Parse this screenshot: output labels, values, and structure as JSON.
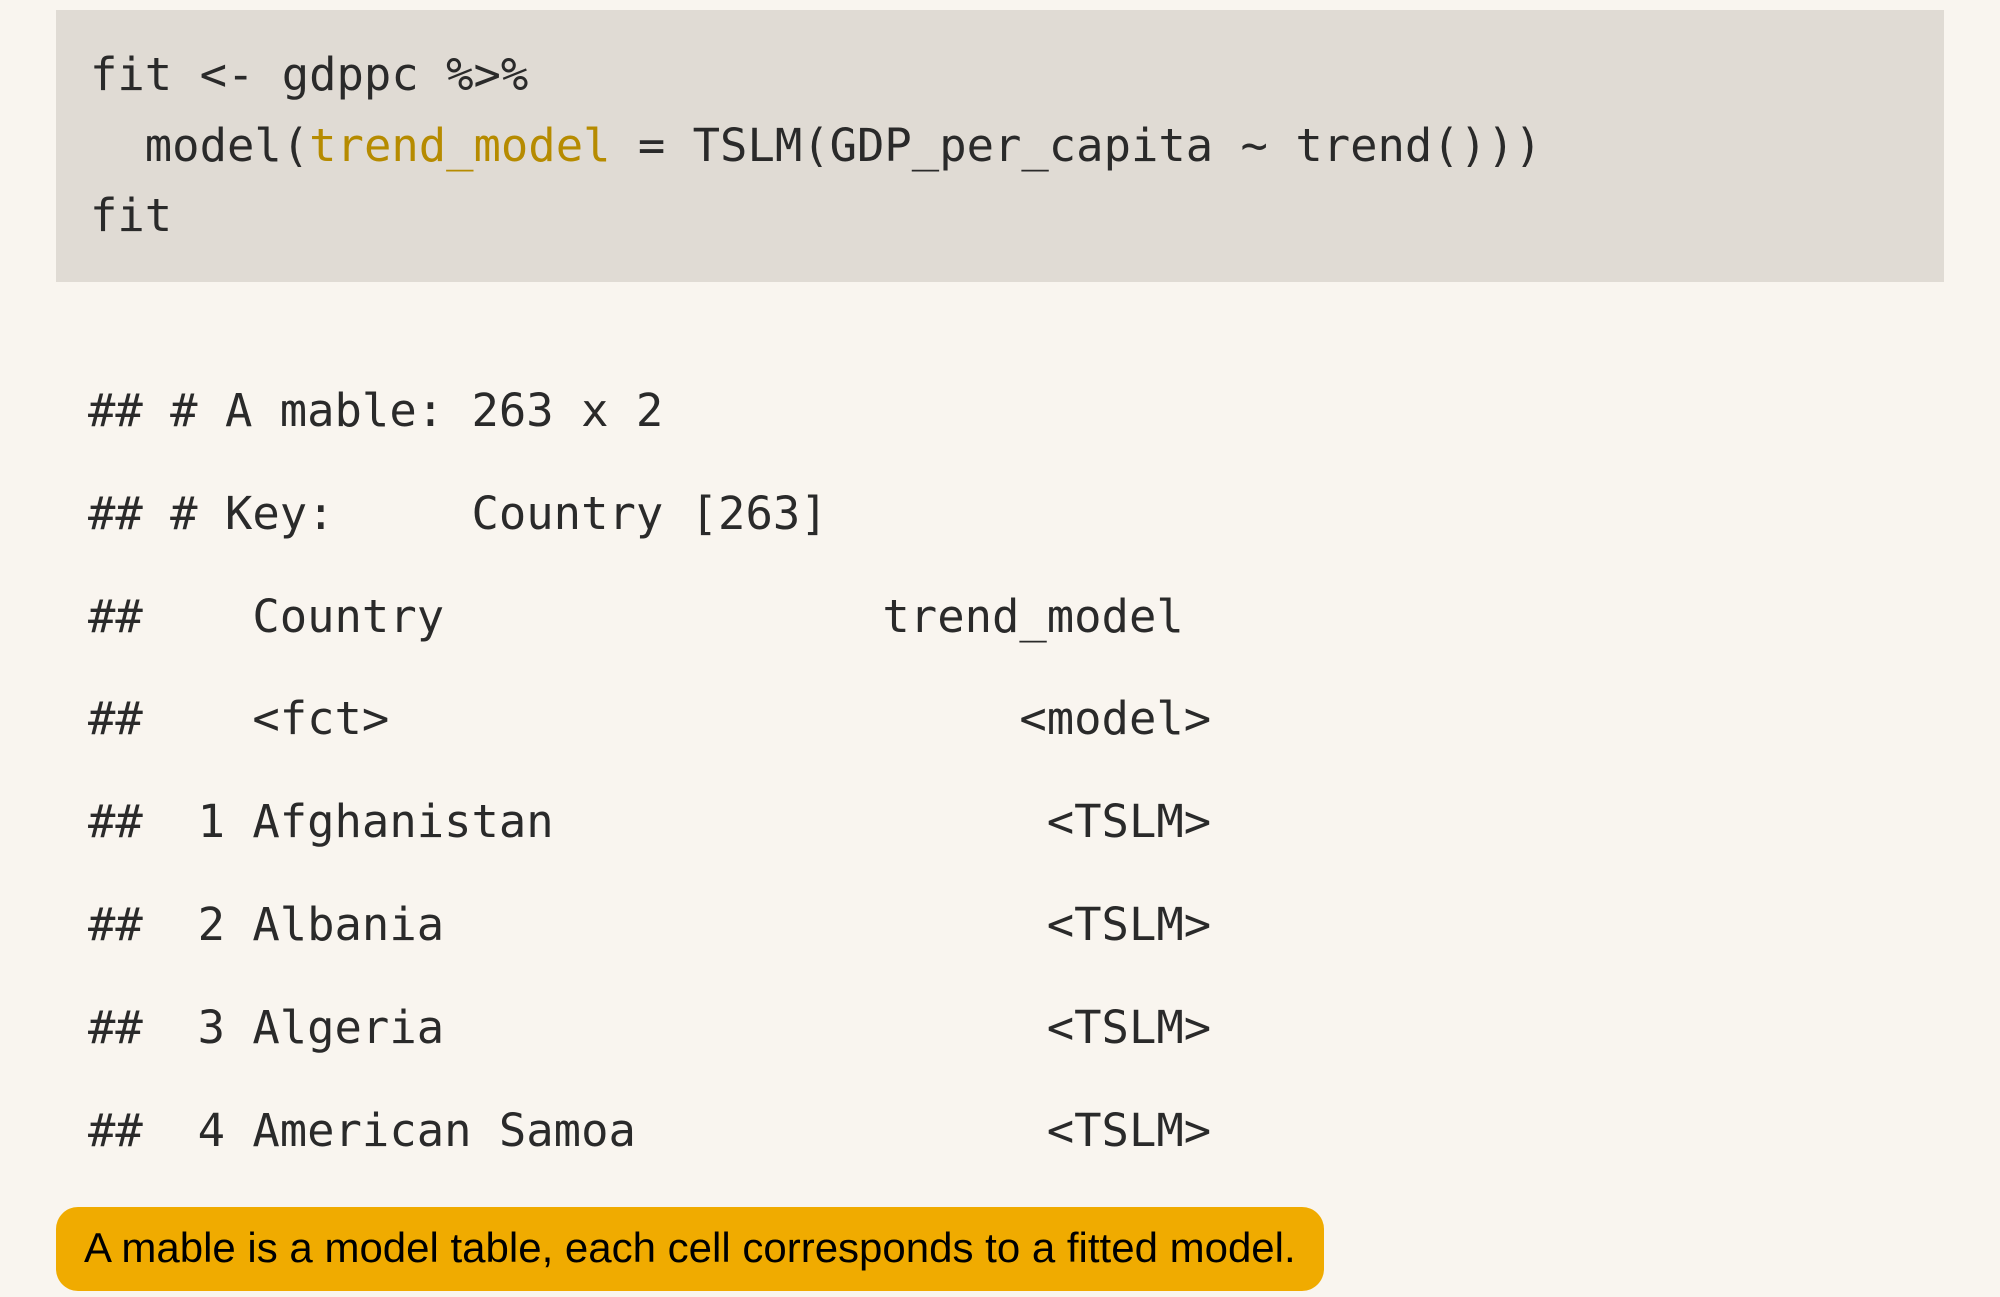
{
  "code": {
    "line1_pre": "fit <- gdppc %>%",
    "line2_pre": "  model(",
    "line2_arg": "trend_model",
    "line2_post": " = TSLM(GDP_per_capita ~ trend()))",
    "line3_pre": "fit"
  },
  "output": {
    "header1": "## # A mable: 263 x 2",
    "header2": "## # Key:     Country [263]",
    "colnames": "##    Country                trend_model",
    "coltypes": "##    <fct>                       <model>",
    "rows": [
      "##  1 Afghanistan                  <TSLM>",
      "##  2 Albania                      <TSLM>",
      "##  3 Algeria                      <TSLM>",
      "##  4 American Samoa               <TSLM>"
    ]
  },
  "callout_text": "A mable is a model table, each cell corresponds to a fitted model."
}
